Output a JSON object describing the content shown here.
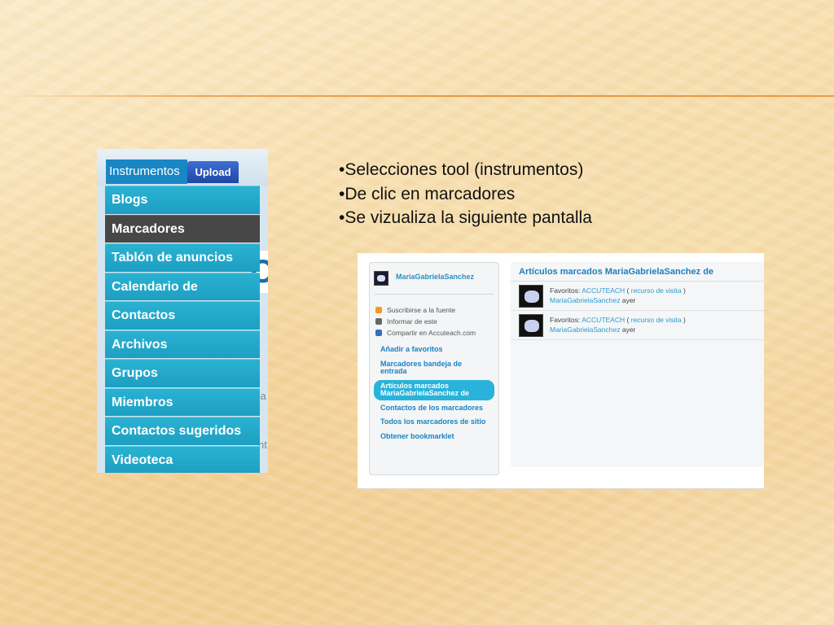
{
  "colors": {
    "menu_item": "#1d9fc2",
    "menu_active": "#474747",
    "accent_line": "#e8963c",
    "link_blue": "#2b9bd0"
  },
  "menu_shot": {
    "tab_instrumentos": "Instrumentos",
    "tab_upload": "Upload",
    "bg_logo_text": "C",
    "bg_text1": "Sa",
    "bg_text2": "nt",
    "items": [
      {
        "label": "Blogs",
        "active": false
      },
      {
        "label": "Marcadores",
        "active": true
      },
      {
        "label": "Tablón de anuncios",
        "active": false
      },
      {
        "label": "Calendario de",
        "active": false
      },
      {
        "label": "Contactos",
        "active": false
      },
      {
        "label": "Archivos",
        "active": false
      },
      {
        "label": "Grupos",
        "active": false
      },
      {
        "label": "Miembros",
        "active": false
      },
      {
        "label": "Contactos sugeridos",
        "active": false
      },
      {
        "label": "Videoteca",
        "active": false
      }
    ]
  },
  "bullets": [
    "•Selecciones tool (instrumentos)",
    "•De clic en marcadores",
    "•Se vizualiza la siguiente pantalla"
  ],
  "page_shot": {
    "sidebar": {
      "user_name": "MariaGabrielaSanchez",
      "links": [
        {
          "label": "Suscribirse a la fuente",
          "icon": "rss-icon"
        },
        {
          "label": "Informar de este",
          "icon": "flag-icon"
        },
        {
          "label": "Compartir en Accuteach.com",
          "icon": "share-icon"
        }
      ],
      "nav": [
        {
          "label": "Añadir a favoritos",
          "active": false
        },
        {
          "label": "Marcadores bandeja de entrada",
          "active": false
        },
        {
          "label": "Artículos marcados MariaGabrielaSanchez de",
          "active": true
        },
        {
          "label": "Contactos de los marcadores",
          "active": false
        },
        {
          "label": "Todos los marcadores de sitio",
          "active": false
        },
        {
          "label": "Obtener bookmarklet",
          "active": false
        }
      ]
    },
    "main": {
      "title": "Artículos marcados MariaGabrielaSanchez de",
      "entries": [
        {
          "favoritos_label": "Favoritos:",
          "site": "ACCUTEACH",
          "open_paren": "(",
          "recurso": "recurso de visita",
          "close_paren": ")",
          "user": "MariaGabrielaSanchez",
          "when": "ayer"
        },
        {
          "favoritos_label": "Favoritos:",
          "site": "ACCUTEACH",
          "open_paren": "(",
          "recurso": "recurso de visita",
          "close_paren": ")",
          "user": "MariaGabrielaSanchez",
          "when": "ayer"
        }
      ]
    }
  }
}
